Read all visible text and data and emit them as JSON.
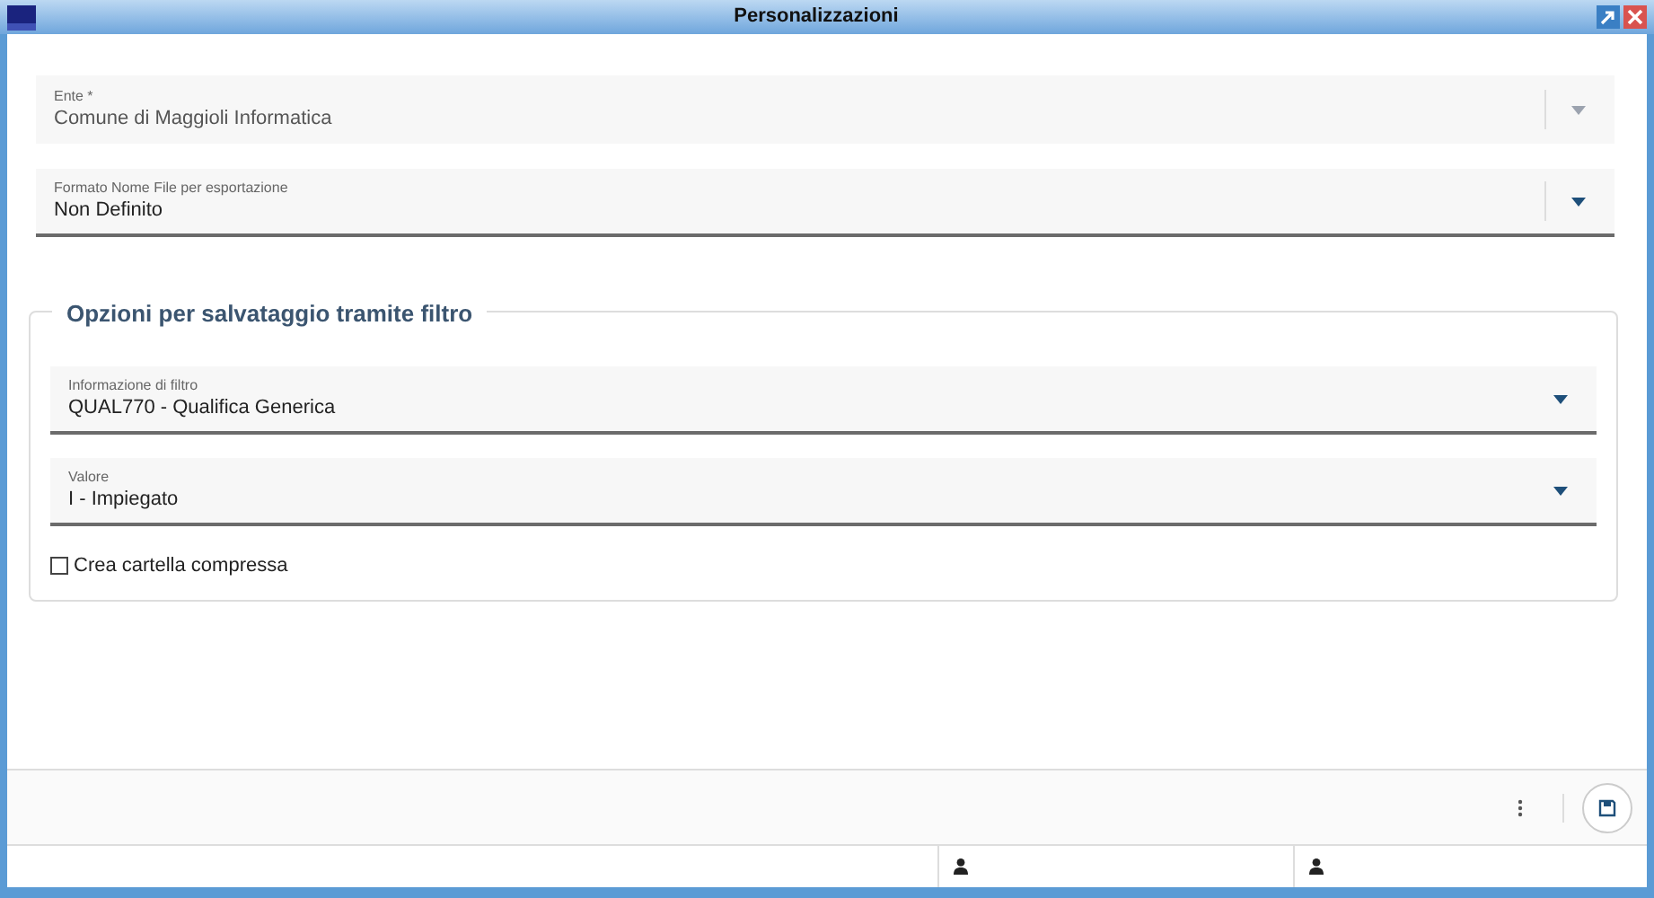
{
  "window": {
    "title": "Personalizzazioni"
  },
  "fields": [
    {
      "label": "Ente *",
      "value": "Comune di Maggioli Informatica",
      "disabled": true
    },
    {
      "label": "Formato Nome File per esportazione",
      "value": "Non Definito",
      "disabled": false
    }
  ],
  "filter_group": {
    "title": "Opzioni per salvataggio tramite filtro",
    "fields": [
      {
        "label": "Informazione di filtro",
        "value": "QUAL770 - Qualifica Generica",
        "disabled": false
      },
      {
        "label": "Valore",
        "value": "I - Impiegato",
        "disabled": false
      }
    ],
    "checkbox": {
      "label": "Crea cartella compressa",
      "checked": false
    }
  },
  "status_bar": [
    {
      "kind": "blank"
    },
    {
      "kind": "user"
    },
    {
      "kind": "user"
    }
  ]
}
